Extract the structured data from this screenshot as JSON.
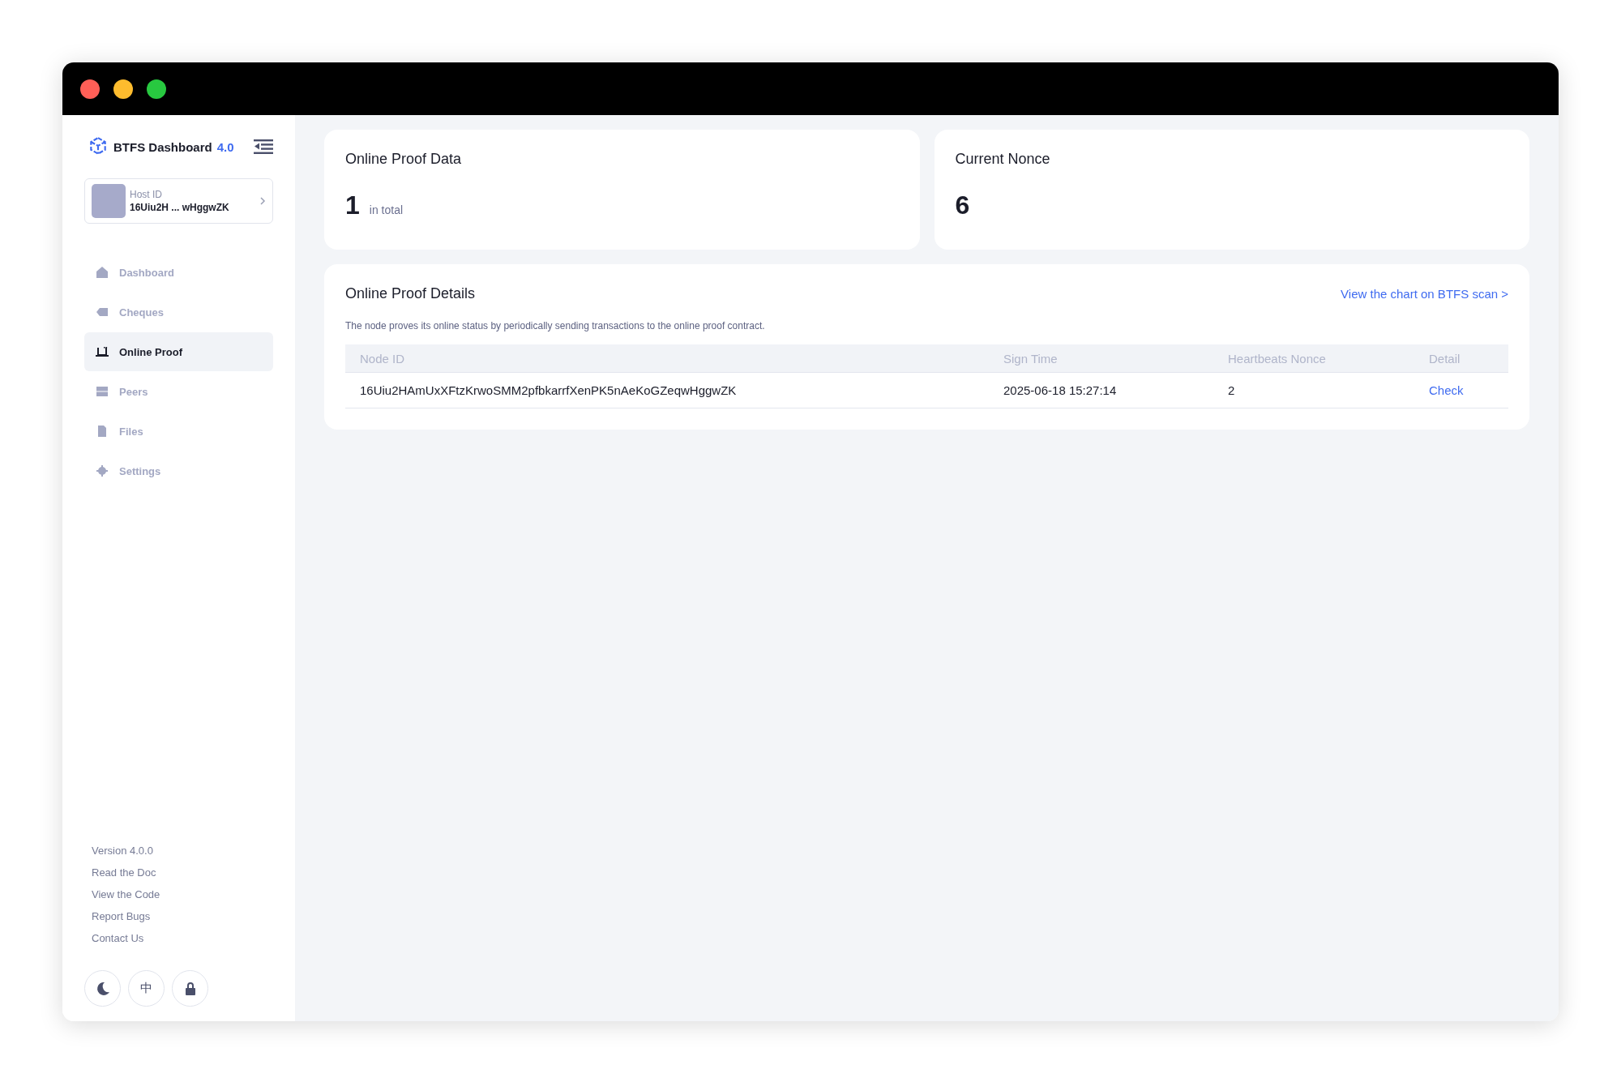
{
  "sidebar": {
    "brand": {
      "name": "BTFS Dashboard",
      "version": "4.0"
    },
    "host": {
      "label": "Host ID",
      "value": "16Uiu2H ... wHggwZK"
    },
    "nav": [
      {
        "label": "Dashboard",
        "selected": false
      },
      {
        "label": "Cheques",
        "selected": false
      },
      {
        "label": "Online Proof",
        "selected": true
      },
      {
        "label": "Peers",
        "selected": false
      },
      {
        "label": "Files",
        "selected": false
      },
      {
        "label": "Settings",
        "selected": false
      }
    ],
    "links": [
      "Version 4.0.0",
      "Read the Doc",
      "View the Code",
      "Report Bugs",
      "Contact Us"
    ],
    "toggles": [
      {
        "kind": "theme"
      },
      {
        "kind": "language",
        "label": "中"
      },
      {
        "kind": "lock"
      }
    ]
  },
  "cards": [
    {
      "title": "Online Proof Data",
      "value": "1",
      "unit": "in total"
    },
    {
      "title": "Current Nonce",
      "value": "6"
    }
  ],
  "details": {
    "title": "Online Proof Details",
    "link": "View the chart on BTFS scan >",
    "description": "The node proves its online status by periodically sending transactions to the online proof contract.",
    "columns": [
      "Node ID",
      "Sign Time",
      "Heartbeats Nonce",
      "Detail"
    ],
    "rows": [
      {
        "node_id": "16Uiu2HAmUxXFtzKrwoSMM2pfbkarrfXenPK5nAeKoGZeqwHggwZK",
        "sign_time": "2025-06-18 15:27:14",
        "nonce": "2",
        "action": "Check"
      }
    ]
  }
}
